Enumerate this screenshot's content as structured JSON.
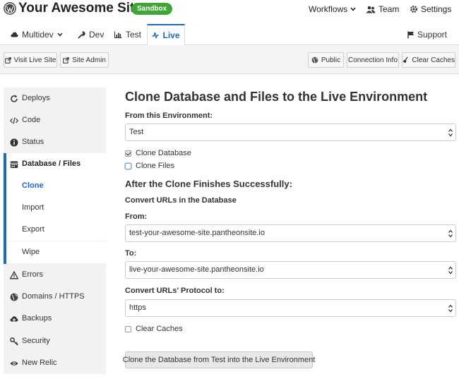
{
  "header": {
    "site_title": "Your Awesome Site",
    "badge": "Sandbox",
    "links": {
      "workflows": "Workflows",
      "team": "Team",
      "settings": "Settings"
    }
  },
  "env_tabs": {
    "multidev": "Multidev",
    "dev": "Dev",
    "test": "Test",
    "live": "Live",
    "active": "Live",
    "support": "Support"
  },
  "actions": {
    "visit_live_site": "Visit Live Site",
    "site_admin": "Site Admin",
    "public": "Public",
    "connection_info": "Connection Info",
    "clear_caches": "Clear Caches"
  },
  "sidebar": {
    "items": [
      {
        "label": "Deploys",
        "icon": "refresh-icon"
      },
      {
        "label": "Code",
        "icon": "code-icon"
      },
      {
        "label": "Status",
        "icon": "info-icon"
      },
      {
        "label": "Database / Files",
        "icon": "database-icon"
      },
      {
        "label": "Clone"
      },
      {
        "label": "Import"
      },
      {
        "label": "Export"
      },
      {
        "label": "Wipe"
      },
      {
        "label": "Errors",
        "icon": "warning-icon"
      },
      {
        "label": "Domains / HTTPS",
        "icon": "globe-icon"
      },
      {
        "label": "Backups",
        "icon": "cloud-upload-icon"
      },
      {
        "label": "Security",
        "icon": "key-icon"
      },
      {
        "label": "New Relic",
        "icon": "eye-icon"
      }
    ],
    "current": "Clone"
  },
  "form": {
    "title": "Clone Database and Files to the Live Environment",
    "from_env_label": "From this Environment:",
    "from_env_value": "Test",
    "clone_database_label": "Clone Database",
    "clone_database_checked": true,
    "clone_files_label": "Clone Files",
    "clone_files_checked": false,
    "after_heading": "After the Clone Finishes Successfully:",
    "convert_urls_label": "Convert URLs in the Database",
    "from_label": "From:",
    "from_value": "test-your-awesome-site.pantheonsite.io",
    "to_label": "To:",
    "to_value": "live-your-awesome-site.pantheonsite.io",
    "protocol_label": "Convert URLs' Protocol to:",
    "protocol_value": "https",
    "clear_caches_label": "Clear Caches",
    "clear_caches_checked": false,
    "submit_label": "Clone the Database from Test into the Live Environment"
  },
  "colors": {
    "accent": "#1a6ac4",
    "badge": "#3fa535",
    "sidebar_bg": "#f2f2f2"
  }
}
